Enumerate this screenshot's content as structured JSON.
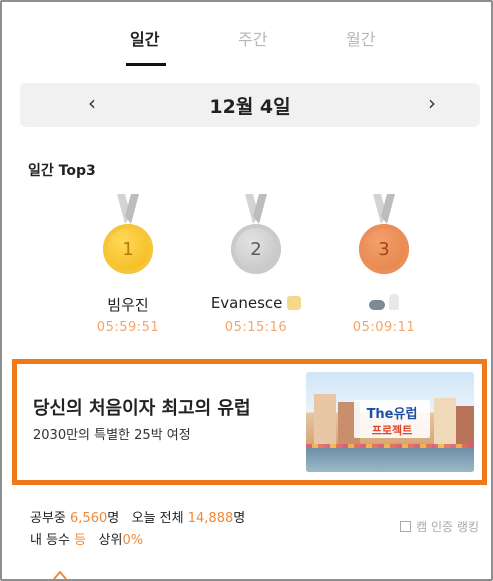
{
  "tabs": [
    {
      "label": "일간",
      "active": true
    },
    {
      "label": "주간",
      "active": false
    },
    {
      "label": "월간",
      "active": false
    }
  ],
  "date_nav": {
    "prev": "‹",
    "label": "12월 4일",
    "next": "›"
  },
  "section_title": "일간 Top3",
  "top3": [
    {
      "rank": "1",
      "name": "빔우진",
      "time": "05:59:51",
      "medal": "gold",
      "ribbon_color": "#c8c8c8"
    },
    {
      "rank": "2",
      "name": "Evanesce",
      "time": "05:15:16",
      "medal": "silver",
      "ribbon_color": "#c8c8c8"
    },
    {
      "rank": "3",
      "name": "",
      "time": "05:09:11",
      "medal": "bronze",
      "ribbon_color": "#c8c8c8"
    }
  ],
  "ad": {
    "title": "당신의 처음이자 최고의 유럽",
    "subtitle": "2030만의 특별한 25박 여정",
    "logo_line1": "The유럽",
    "logo_line2": "프로젝트",
    "border_color": "#ef7a1c"
  },
  "stats": {
    "studying_label": "공부중",
    "studying_count": "6,560",
    "studying_unit": "명",
    "today_label": "오늘 전체",
    "today_count": "14,888",
    "today_unit": "명",
    "my_rank_label": "내 등수",
    "my_rank_value": "등",
    "top_label": "상위",
    "top_value": "0%"
  },
  "cam_filter": {
    "label": "캠 인증 랭킹",
    "checked": false
  },
  "colors": {
    "accent": "#f08a3a",
    "time": "#f5a46b",
    "gold": "#f2b10b",
    "silver": "#bdbdbd",
    "bronze": "#e07d43"
  }
}
